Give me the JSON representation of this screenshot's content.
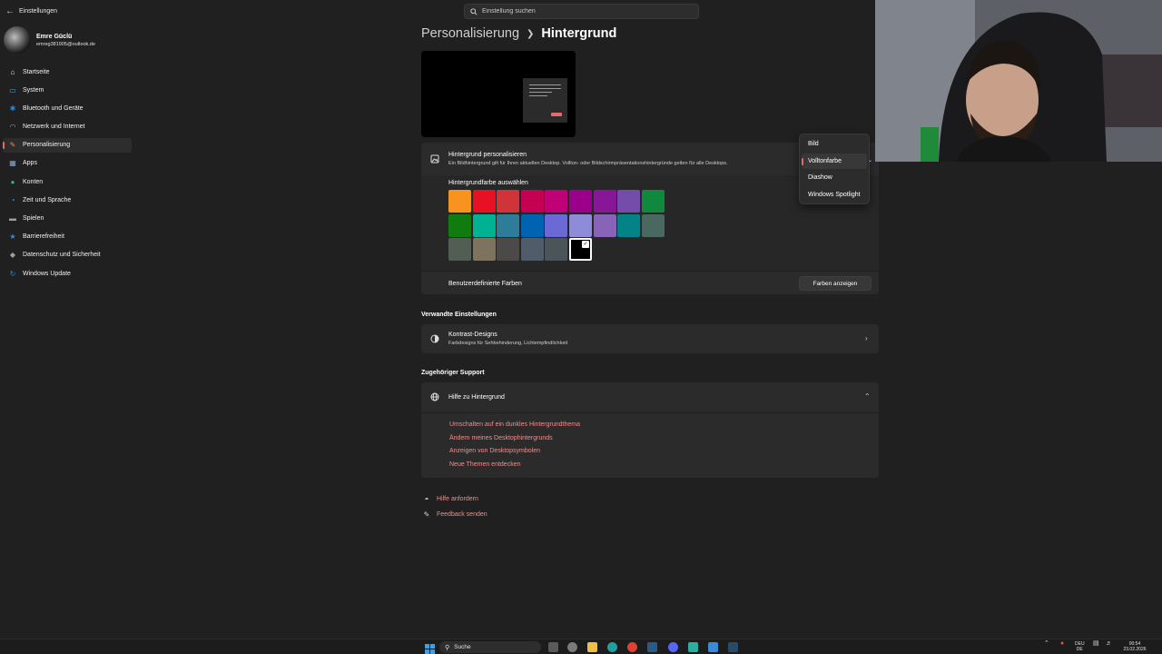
{
  "app": {
    "title": "Einstellungen"
  },
  "search": {
    "placeholder": "Einstellung suchen"
  },
  "profile": {
    "name": "Emre Güclü",
    "email": "emreg381905@outlook.de"
  },
  "sidebar": {
    "items": [
      {
        "label": "Startseite",
        "icon": "home-icon",
        "color": "#e8e8e8"
      },
      {
        "label": "System",
        "icon": "monitor-icon",
        "color": "#2aa6e0"
      },
      {
        "label": "Bluetooth und Geräte",
        "icon": "bluetooth-icon",
        "color": "#2a88e0"
      },
      {
        "label": "Netzwerk und Internet",
        "icon": "wifi-icon",
        "color": "#5aaee8"
      },
      {
        "label": "Personalisierung",
        "icon": "brush-icon",
        "color": "#e88a4a"
      },
      {
        "label": "Apps",
        "icon": "apps-icon",
        "color": "#8aa6c8"
      },
      {
        "label": "Konten",
        "icon": "person-icon",
        "color": "#3ab07a"
      },
      {
        "label": "Zeit und Sprache",
        "icon": "globe-clock-icon",
        "color": "#3a9ae0"
      },
      {
        "label": "Spielen",
        "icon": "gamepad-icon",
        "color": "#9aa0a8"
      },
      {
        "label": "Barrierefreiheit",
        "icon": "accessibility-icon",
        "color": "#3a8ae8"
      },
      {
        "label": "Datenschutz und Sicherheit",
        "icon": "shield-icon",
        "color": "#9aa0a8"
      },
      {
        "label": "Windows Update",
        "icon": "update-icon",
        "color": "#2a88e0"
      }
    ],
    "active_index": 4
  },
  "breadcrumb": {
    "parent": "Personalisierung",
    "current": "Hintergrund"
  },
  "background_card": {
    "title": "Hintergrund personalisieren",
    "subtitle": "Ein Bildhintergrund gilt für Ihren aktuellen Desktop. Vollton- oder Bildschirmpräsentationshintergründe gelten für alle Desktops.",
    "color_label": "Hintergrundfarbe auswählen",
    "custom_label": "Benutzerdefinierte Farben",
    "custom_button": "Farben anzeigen",
    "swatches": [
      [
        "#f7931e",
        "#e81123",
        "#d13438",
        "#c30052",
        "#bf0077",
        "#9a0089",
        "#881798",
        "#744da9",
        "#10893e"
      ],
      [
        "#107c10",
        "#00b294",
        "#2d7d9a",
        "#0063b1",
        "#6b69d6",
        "#8e8cd8",
        "#8764b8",
        "#038387",
        "#486860"
      ],
      [
        "#525e54",
        "#7e735f",
        "#4c4a48",
        "#515c6b",
        "#4a5459",
        "#000000"
      ]
    ],
    "selected_swatch": "#000000"
  },
  "dropdown": {
    "options": [
      "Bild",
      "Volltonfarbe",
      "Diashow",
      "Windows Spotlight"
    ],
    "selected": "Volltonfarbe"
  },
  "related": {
    "heading": "Verwandte Einstellungen",
    "kontrast_title": "Kontrast-Designs",
    "kontrast_sub": "Farbdesigns für Sehbehinderung, Lichtempfindlichkeit"
  },
  "support": {
    "heading": "Zugehöriger Support",
    "help_title": "Hilfe zu Hintergrund",
    "links": [
      "Umschalten auf ein dunkles Hintergrundthema",
      "Ändern meines Desktophintergrunds",
      "Anzeigen von Desktopsymbolen",
      "Neue Themen entdecken"
    ]
  },
  "footer": {
    "help": "Hilfe anfordern",
    "feedback": "Feedback senden"
  },
  "taskbar": {
    "search": "Suche",
    "lang_top": "DEU",
    "lang_bottom": "DE",
    "time": "00:54",
    "date": "23.02.2026"
  }
}
